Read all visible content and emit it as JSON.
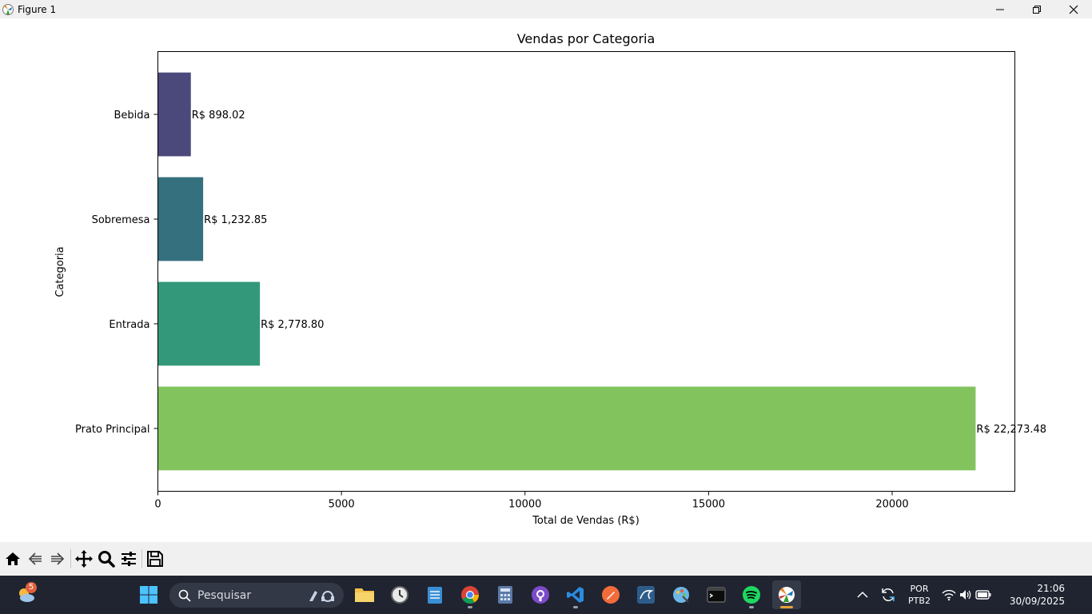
{
  "window": {
    "title": "Figure 1",
    "minimize_icon": "minimize-icon",
    "maximize_icon": "restore-icon",
    "close_icon": "close-icon"
  },
  "chart_data": {
    "type": "bar",
    "orientation": "horizontal",
    "title": "Vendas por Categoria",
    "xlabel": "Total de Vendas (R$)",
    "ylabel": "Categoria",
    "categories": [
      "Prato Principal",
      "Entrada",
      "Sobremesa",
      "Bebida"
    ],
    "values": [
      22273.48,
      2778.8,
      1232.85,
      898.02
    ],
    "data_labels": [
      "R$ 22,273.48",
      "R$ 2,778.80",
      "R$ 1,232.85",
      "R$ 898.02"
    ],
    "colors": [
      "#82c35e",
      "#33987a",
      "#35707e",
      "#4b497b"
    ],
    "xlim": [
      0,
      23342
    ],
    "xticks": [
      0,
      5000,
      10000,
      15000,
      20000
    ],
    "xtick_labels": [
      "0",
      "5000",
      "10000",
      "15000",
      "20000"
    ],
    "grid": false,
    "legend": "none"
  },
  "toolbar": {
    "buttons": [
      "home-icon",
      "back-icon",
      "forward-icon",
      "pan-icon",
      "zoom-icon",
      "configure-subplots-icon",
      "save-icon"
    ]
  },
  "taskbar": {
    "weather_badge": "5",
    "search_placeholder": "Pesquisar",
    "language_line1": "POR",
    "language_line2": "PTB2",
    "time": "21:06",
    "date": "30/09/2025"
  }
}
